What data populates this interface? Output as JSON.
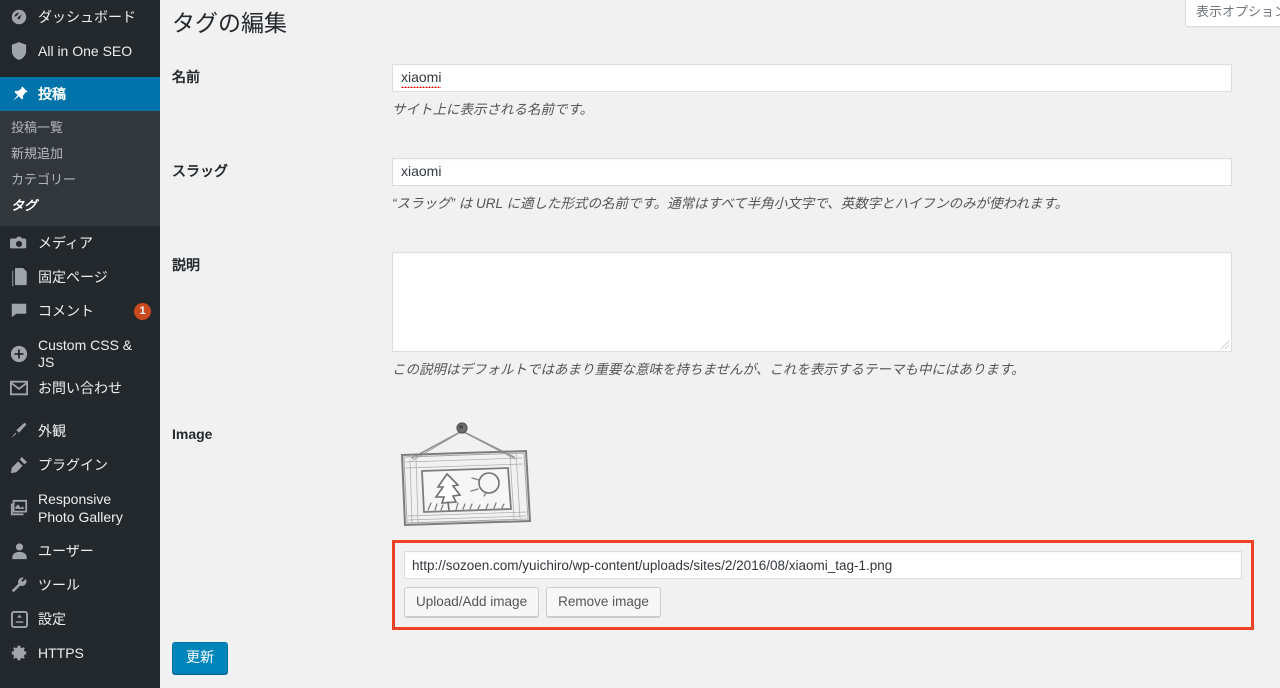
{
  "sidebar": {
    "items": [
      {
        "label": "ダッシュボード",
        "icon": "dashboard-icon",
        "type": "top"
      },
      {
        "label": "All in One SEO",
        "icon": "shield-icon",
        "type": "top"
      },
      {
        "label": "投稿",
        "icon": "pin-icon",
        "type": "top",
        "current": true
      },
      {
        "label": "メディア",
        "icon": "media-camera-icon",
        "type": "top"
      },
      {
        "label": "固定ページ",
        "icon": "pages-icon",
        "type": "top"
      },
      {
        "label": "コメント",
        "icon": "comment-bubble-icon",
        "type": "top",
        "badge": "1"
      },
      {
        "label": "Custom CSS & JS",
        "icon": "plus-circle-icon",
        "type": "top"
      },
      {
        "label": "お問い合わせ",
        "icon": "envelope-icon",
        "type": "top"
      },
      {
        "label": "外観",
        "icon": "paintbrush-icon",
        "type": "top"
      },
      {
        "label": "プラグイン",
        "icon": "plug-icon",
        "type": "top"
      },
      {
        "label": "Responsive Photo Gallery",
        "icon": "gallery-icon",
        "type": "top"
      },
      {
        "label": "ユーザー",
        "icon": "user-icon",
        "type": "top"
      },
      {
        "label": "ツール",
        "icon": "wrench-icon",
        "type": "top"
      },
      {
        "label": "設定",
        "icon": "settings-slider-icon",
        "type": "top"
      },
      {
        "label": "HTTPS",
        "icon": "plugin-gear-icon",
        "type": "top"
      }
    ],
    "submenu": [
      {
        "label": "投稿一覧"
      },
      {
        "label": "新規追加"
      },
      {
        "label": "カテゴリー"
      },
      {
        "label": "タグ",
        "current": true
      }
    ]
  },
  "header": {
    "screen_options_label": "表示オプション",
    "page_title": "タグの編集"
  },
  "form": {
    "name": {
      "label": "名前",
      "value": "xiaomi",
      "help": "サイト上に表示される名前です。"
    },
    "slug": {
      "label": "スラッグ",
      "value": "xiaomi",
      "help": "“スラッグ” は URL に適した形式の名前です。通常はすべて半角小文字で、英数字とハイフンのみが使われます。"
    },
    "description": {
      "label": "説明",
      "value": "",
      "help": "この説明はデフォルトではあまり重要な意味を持ちませんが、これを表示するテーマも中にはあります。"
    },
    "image": {
      "label": "Image",
      "url_value": "http://sozoen.com/yuichiro/wp-content/uploads/sites/2/2016/08/xiaomi_tag-1.png",
      "upload_button": "Upload/Add image",
      "remove_button": "Remove image"
    },
    "submit_label": "更新"
  },
  "colors": {
    "sidebar_bg": "#23282d",
    "submenu_bg": "#32373c",
    "accent_blue": "#0073aa",
    "primary_button": "#0085ba",
    "badge_orange": "#ca4a1f",
    "annotation_red": "#ef4123",
    "content_bg": "#f1f1f1"
  }
}
